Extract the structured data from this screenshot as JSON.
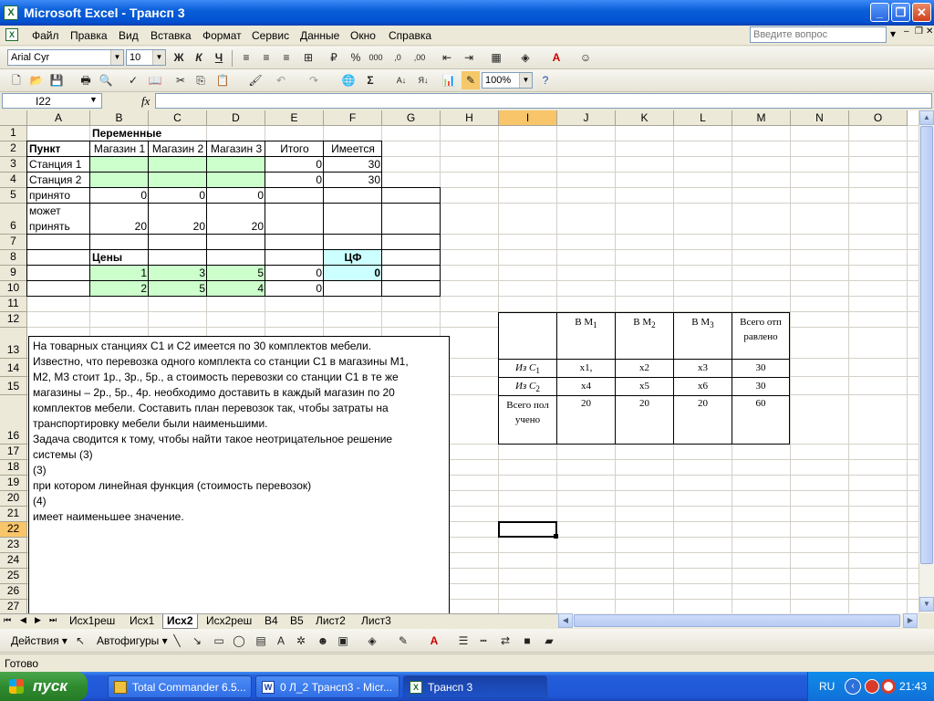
{
  "window": {
    "title": "Microsoft Excel - Трансп 3"
  },
  "menu": [
    "Файл",
    "Правка",
    "Вид",
    "Вставка",
    "Формат",
    "Сервис",
    "Данные",
    "Окно",
    "Справка"
  ],
  "help_box": {
    "placeholder": "Введите вопрос"
  },
  "format_toolbar": {
    "font": "Arial Cyr",
    "size": "10",
    "bold": "Ж",
    "italic": "К",
    "underline": "Ч"
  },
  "standard_toolbar": {
    "zoom": "100%"
  },
  "formula_bar": {
    "name_box": "I22",
    "fx": "fx"
  },
  "columns": [
    "A",
    "B",
    "C",
    "D",
    "E",
    "F",
    "G",
    "H",
    "I",
    "J",
    "K",
    "L",
    "M",
    "N",
    "O"
  ],
  "rows": [
    "1",
    "2",
    "3",
    "4",
    "5",
    "6",
    "7",
    "8",
    "9",
    "10",
    "11",
    "12",
    "13",
    "14",
    "15",
    "16",
    "17",
    "18",
    "19",
    "20",
    "21",
    "22",
    "23",
    "24",
    "25",
    "26",
    "27"
  ],
  "cells": {
    "b1": "Переменные",
    "a2": "Пункт",
    "b2": "Магазин 1",
    "c2": "Магазин 2",
    "d2": "Магазин 3",
    "e2": "Итого",
    "f2": "Имеется",
    "a3": "Станция 1",
    "e3": "0",
    "f3": "30",
    "a4": "Станция 2",
    "e4": "0",
    "f4": "30",
    "a5": "принято",
    "b5": "0",
    "c5": "0",
    "d5": "0",
    "a6a": "может",
    "a6b": "принять",
    "b6": "20",
    "c6": "20",
    "d6": "20",
    "b8": "Цены",
    "f8": "ЦФ",
    "b9": "1",
    "c9": "3",
    "d9": "5",
    "e9": "0",
    "f9": "0",
    "b10": "2",
    "c10": "5",
    "d10": "4",
    "e10": "0"
  },
  "textbox_lines": [
    "На товарных станциях С1 и С2 имеется по 30 комплектов мебели.",
    "Известно, что перевозка одного комплекта со станции С1 в магазины М1,",
    "М2, М3 стоит 1р., 3р., 5р., а стоимость перевозки со станции С1 в те же",
    "магазины – 2р., 5р., 4р. необходимо доставить в каждый магазин по 20",
    "комплектов мебели. Составить план перевозок так, чтобы затраты на",
    "транспортировку мебели были наименьшими.",
    "Задача сводится к тому, чтобы найти такое неотрицательное решение",
    "системы (3)",
    "    (3)",
    "при котором линейная функция (стоимость перевозок)",
    "    (4)",
    "имеет наименьшее значение."
  ],
  "transport_table": {
    "h_m1": "В М",
    "h_m1_sub": "1",
    "h_m2": "В М",
    "h_m2_sub": "2",
    "h_m3": "В М",
    "h_m3_sub": "3",
    "h_total": "Всего отправлено",
    "r1_label": "Из C",
    "r1_label_sub": "1",
    "r1": [
      "x1,",
      "x2",
      "x3",
      "30"
    ],
    "r2_label": "Из C",
    "r2_label_sub": "2",
    "r2": [
      "x4",
      "x5",
      "x6",
      "30"
    ],
    "r3_label": "Всего получено",
    "r3": [
      "20",
      "20",
      "20",
      "60"
    ]
  },
  "sheet_tabs": [
    "Исх1реш",
    "Исх1",
    "Исх2",
    "Исх2реш",
    "В4",
    "В5",
    "Лист2",
    "Лист3"
  ],
  "active_tab": "Исх2",
  "draw_toolbar": {
    "actions": "Действия",
    "autoshapes": "Автофигуры"
  },
  "status": "Готово",
  "taskbar": {
    "start": "пуск",
    "tasks": [
      "Total Commander 6.5...",
      "0 Л_2 Трансп3 - Micr...",
      "Трансп 3"
    ],
    "lang": "RU",
    "clock": "21:43"
  }
}
